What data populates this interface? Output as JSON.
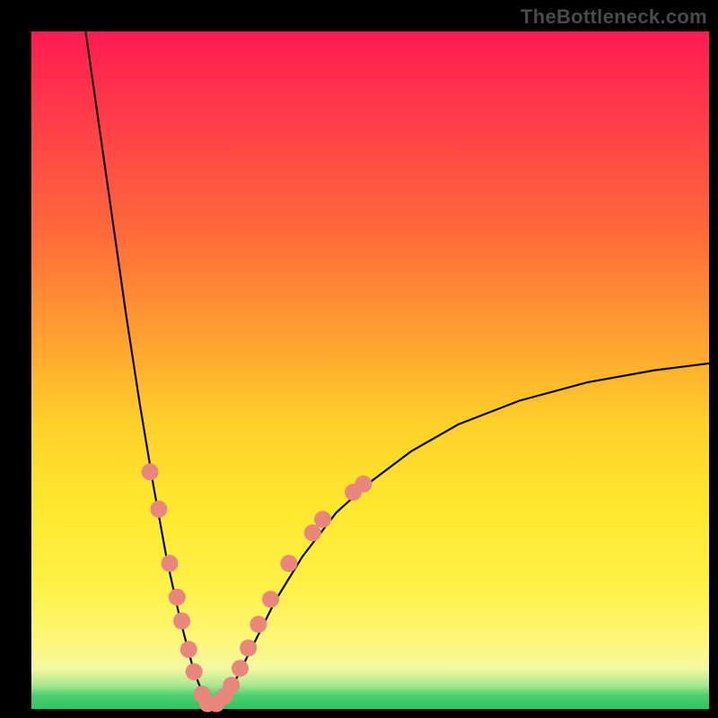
{
  "watermark": "TheBottleneck.com",
  "colors": {
    "background": "#000000",
    "gradient_top": "#ff1b52",
    "gradient_mid": "#ffd12a",
    "gradient_bottom": "#2cc463",
    "curve": "#0a0a0a",
    "dots": "#e9877c"
  },
  "chart_data": {
    "type": "line",
    "title": "",
    "xlabel": "",
    "ylabel": "",
    "xlim": [
      0,
      100
    ],
    "ylim": [
      0,
      100
    ],
    "x_min_point": 26,
    "curve_description": "V-shaped bottleneck curve with minimum near x≈26; left branch reaches y≈100 at x≈8, right branch ends near y≈51 at x=100",
    "curve_points": [
      {
        "x": 8.0,
        "y": 100.0
      },
      {
        "x": 10.0,
        "y": 86.0
      },
      {
        "x": 12.0,
        "y": 72.0
      },
      {
        "x": 14.0,
        "y": 58.0
      },
      {
        "x": 16.0,
        "y": 45.0
      },
      {
        "x": 18.0,
        "y": 33.0
      },
      {
        "x": 20.0,
        "y": 22.0
      },
      {
        "x": 22.0,
        "y": 13.0
      },
      {
        "x": 24.0,
        "y": 5.5
      },
      {
        "x": 26.0,
        "y": 0.5
      },
      {
        "x": 28.0,
        "y": 1.0
      },
      {
        "x": 30.0,
        "y": 4.0
      },
      {
        "x": 33.0,
        "y": 10.0
      },
      {
        "x": 36.0,
        "y": 16.0
      },
      {
        "x": 40.0,
        "y": 22.5
      },
      {
        "x": 45.0,
        "y": 29.0
      },
      {
        "x": 50.0,
        "y": 33.5
      },
      {
        "x": 56.0,
        "y": 38.0
      },
      {
        "x": 63.0,
        "y": 42.0
      },
      {
        "x": 72.0,
        "y": 45.5
      },
      {
        "x": 82.0,
        "y": 48.2
      },
      {
        "x": 92.0,
        "y": 50.0
      },
      {
        "x": 100.0,
        "y": 51.0
      }
    ],
    "dots": [
      {
        "x": 17.5,
        "y": 35.0
      },
      {
        "x": 18.8,
        "y": 29.5
      },
      {
        "x": 20.4,
        "y": 21.5
      },
      {
        "x": 21.5,
        "y": 16.5
      },
      {
        "x": 22.2,
        "y": 13.0
      },
      {
        "x": 23.2,
        "y": 8.8
      },
      {
        "x": 24.0,
        "y": 5.5
      },
      {
        "x": 25.2,
        "y": 2.2
      },
      {
        "x": 26.0,
        "y": 0.8
      },
      {
        "x": 27.3,
        "y": 0.8
      },
      {
        "x": 28.5,
        "y": 1.9
      },
      {
        "x": 29.5,
        "y": 3.5
      },
      {
        "x": 30.8,
        "y": 6.0
      },
      {
        "x": 32.0,
        "y": 9.0
      },
      {
        "x": 33.5,
        "y": 12.5
      },
      {
        "x": 35.3,
        "y": 16.2
      },
      {
        "x": 38.0,
        "y": 21.5
      },
      {
        "x": 41.5,
        "y": 26.0
      },
      {
        "x": 43.0,
        "y": 28.0
      },
      {
        "x": 47.5,
        "y": 32.0
      },
      {
        "x": 49.0,
        "y": 33.2
      }
    ]
  }
}
